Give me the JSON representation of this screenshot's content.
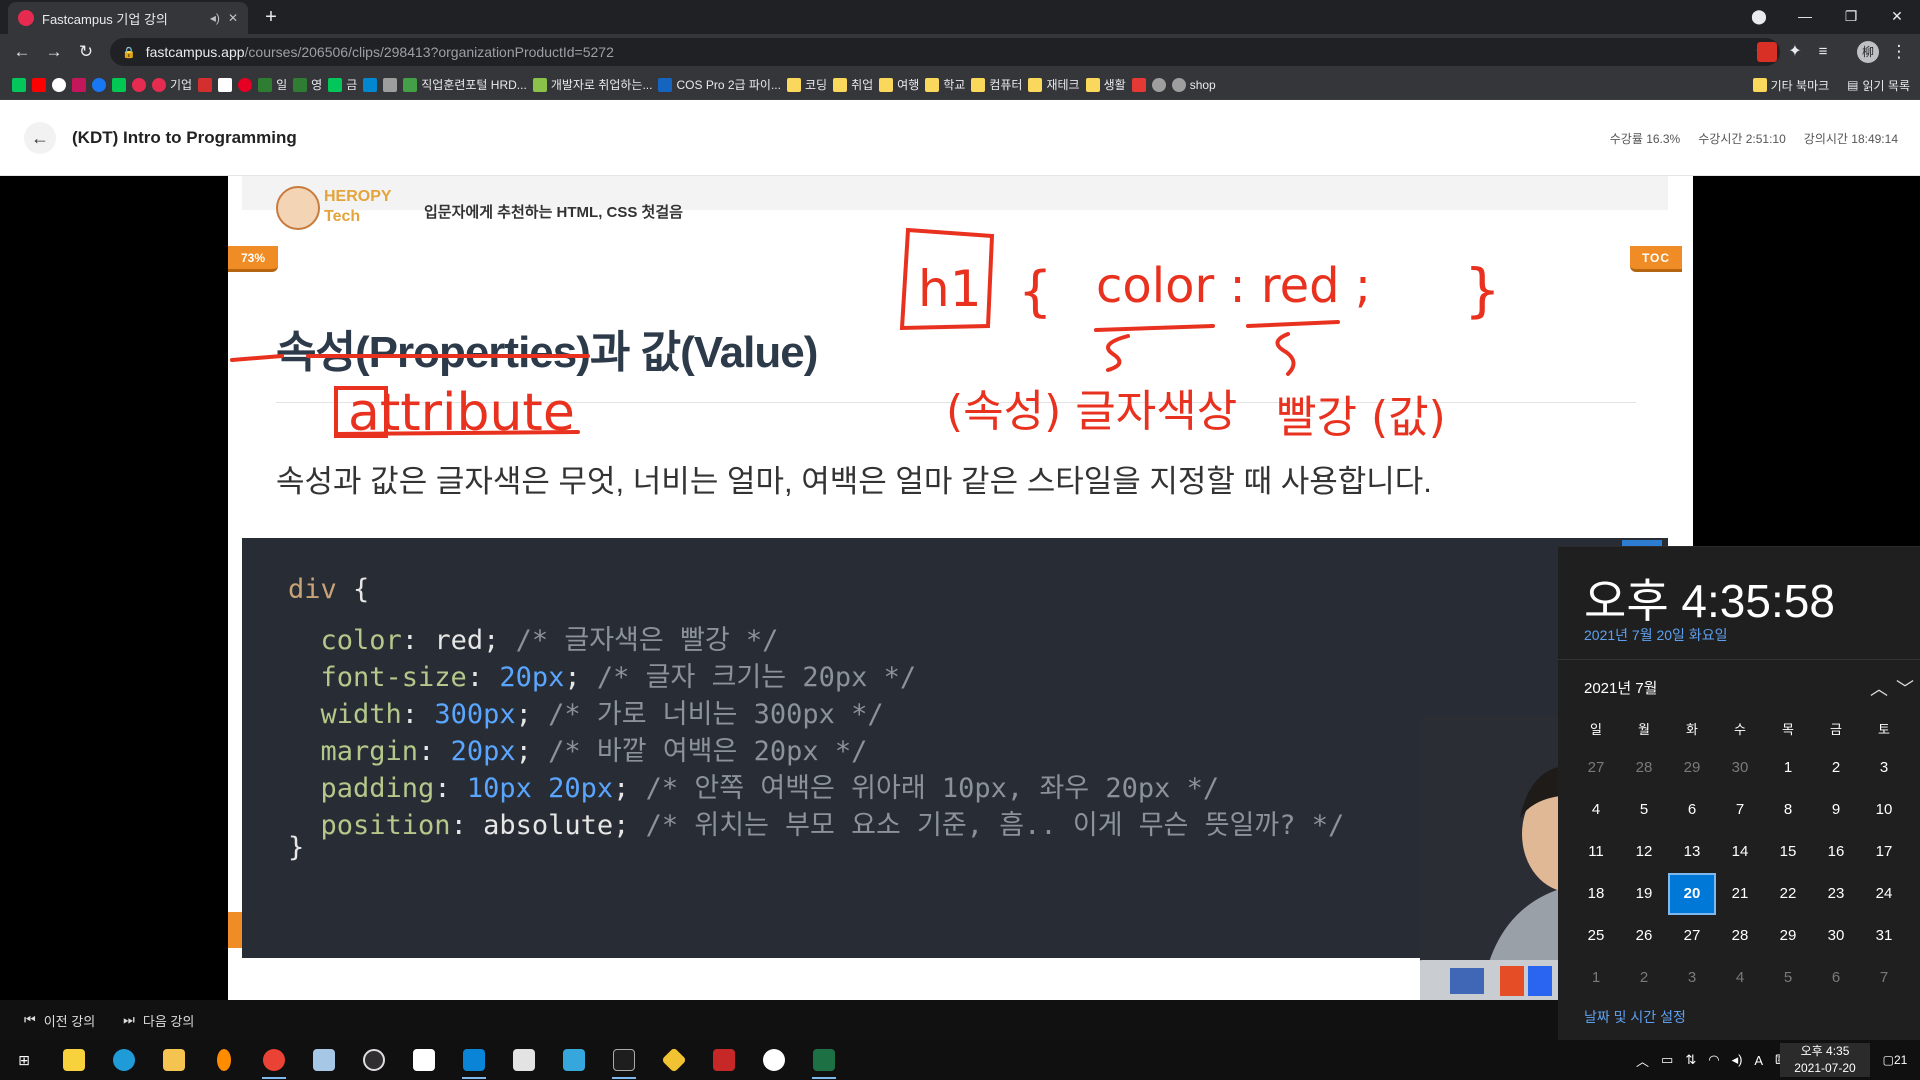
{
  "browser": {
    "tab_title": "Fastcampus 기업 강의",
    "url_host": "fastcampus.app",
    "url_path": "/courses/206506/clips/298413?organizationProductId=5272",
    "bookmarks": [
      "기업",
      "일",
      "영",
      "금",
      "직업훈련포털 HRD...",
      "개발자로 취업하는...",
      "COS Pro 2급 파이...",
      "코딩",
      "취업",
      "여행",
      "학교",
      "컴퓨터",
      "재테크",
      "생활",
      "shop"
    ],
    "bookmarks_other": "기타 북마크",
    "reading_list": "읽기 목록",
    "profile_initial": "柳"
  },
  "page": {
    "course_title": "(KDT) Intro to Programming",
    "stat_progress": "수강률 16.3%",
    "stat_watch_time": "수강시간 2:51:10",
    "stat_lecture_time": "강의시간 18:49:14"
  },
  "slide": {
    "brand_line1": "HEROPY",
    "brand_line2": "Tech",
    "subtitle": "입문자에게 추천하는 HTML, CSS 첫걸음",
    "progress_badge": "73%",
    "toc_badge": "TOC",
    "heading": "속성(Properties)과 값(Value)",
    "description": "속성과 값은 글자색은 무엇, 너비는 얼마, 여백은 얼마 같은 스타일을 지정할 때 사용합니다.",
    "code": {
      "selector": "div",
      "open": "{",
      "close": "}",
      "lines": [
        {
          "prop": "color",
          "value": "red",
          "num": "",
          "comment": "/* 글자색은 빨강 */"
        },
        {
          "prop": "font-size",
          "value": "",
          "num": "20px",
          "comment": "/* 글자 크기는 20px */"
        },
        {
          "prop": "width",
          "value": "",
          "num": "300px",
          "comment": "/* 가로 너비는 300px */"
        },
        {
          "prop": "margin",
          "value": "",
          "num": "20px",
          "comment": "/* 바깥 여백은 20px */"
        },
        {
          "prop": "padding",
          "value": "",
          "num": "10px 20px",
          "comment": "/* 안쪽 여백은 위아래 10px, 좌우 20px */"
        },
        {
          "prop": "position",
          "value": "absolute",
          "num": "",
          "comment": "/* 위치는 부모 요소 기준, 흠.. 이게 무슨 뜻일까? */"
        }
      ]
    },
    "annotations": {
      "attribute": "attribute",
      "h1": "h1",
      "brace_open": "{",
      "color_red": "color : red ;",
      "brace_close": "}",
      "prop_note": "(속성) 글자색상",
      "value_note": "빨강 (값)"
    }
  },
  "bottom_nav": {
    "prev": "이전 강의",
    "next": "다음 강의"
  },
  "calendar": {
    "time": "오후 4:35:58",
    "date_long": "2021년 7월 20일 화요일",
    "month_label": "2021년 7월",
    "weekdays": [
      "일",
      "월",
      "화",
      "수",
      "목",
      "금",
      "토"
    ],
    "weeks": [
      [
        "27",
        "28",
        "29",
        "30",
        "1",
        "2",
        "3"
      ],
      [
        "4",
        "5",
        "6",
        "7",
        "8",
        "9",
        "10"
      ],
      [
        "11",
        "12",
        "13",
        "14",
        "15",
        "16",
        "17"
      ],
      [
        "18",
        "19",
        "20",
        "21",
        "22",
        "23",
        "24"
      ],
      [
        "25",
        "26",
        "27",
        "28",
        "29",
        "30",
        "31"
      ],
      [
        "1",
        "2",
        "3",
        "4",
        "5",
        "6",
        "7"
      ]
    ],
    "today": "20",
    "settings_link": "날짜 및 시간 설정"
  },
  "taskbar": {
    "clock_time": "오후 4:35",
    "clock_date": "2021-07-20",
    "notif_count": "21",
    "ime": "A"
  },
  "colors": {
    "accent": "#0078d7",
    "brand_orange": "#f08c25",
    "annotation_red": "#e8321f",
    "code_bg": "#282c34"
  }
}
